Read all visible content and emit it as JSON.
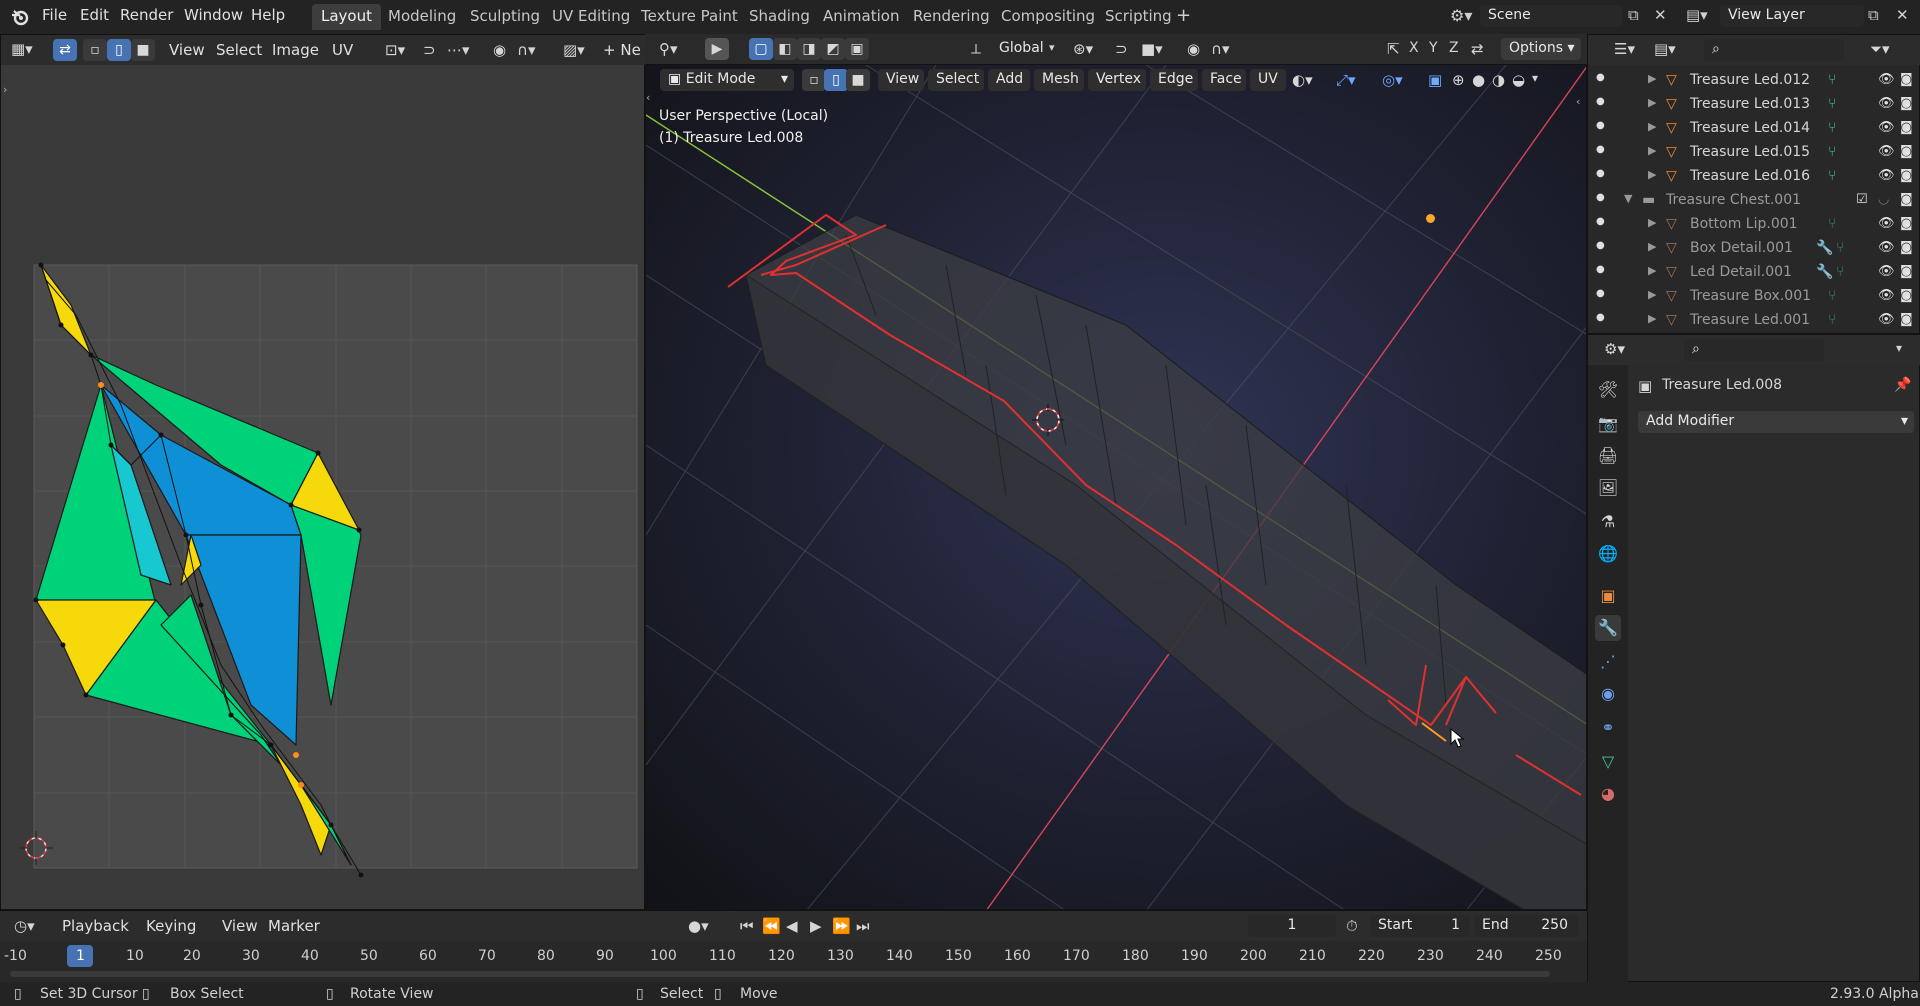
{
  "app": {
    "version": "2.93.0 Alpha"
  },
  "menu": [
    "File",
    "Edit",
    "Render",
    "Window",
    "Help"
  ],
  "workspaces": [
    "Layout",
    "Modeling",
    "Sculpting",
    "UV Editing",
    "Texture Paint",
    "Shading",
    "Animation",
    "Rendering",
    "Compositing",
    "Scripting"
  ],
  "active_workspace": "Layout",
  "scene": {
    "name": "Scene",
    "view_layer": "View Layer"
  },
  "uv_editor": {
    "menus": [
      "View",
      "Select",
      "Image",
      "UV"
    ],
    "new_label": "Ne"
  },
  "viewport_toolbar": {
    "orientation": "Global",
    "options": "Options",
    "axes": [
      "X",
      "Y",
      "Z"
    ]
  },
  "viewport_header": {
    "mode": "Edit Mode",
    "menus": [
      "View",
      "Select",
      "Add",
      "Mesh",
      "Vertex",
      "Edge",
      "Face",
      "UV"
    ]
  },
  "viewport_overlay": {
    "perspective": "User Perspective (Local)",
    "object": "(1) Treasure Led.008"
  },
  "outliner": {
    "rows": [
      {
        "name": "Treasure Led.012",
        "dim": false,
        "kind": "mesh"
      },
      {
        "name": "Treasure Led.013",
        "dim": false,
        "kind": "mesh"
      },
      {
        "name": "Treasure Led.014",
        "dim": false,
        "kind": "mesh"
      },
      {
        "name": "Treasure Led.015",
        "dim": false,
        "kind": "mesh"
      },
      {
        "name": "Treasure Led.016",
        "dim": false,
        "kind": "mesh"
      },
      {
        "name": "Treasure Chest.001",
        "dim": true,
        "kind": "collection"
      },
      {
        "name": "Bottom Lip.001",
        "dim": true,
        "kind": "mesh"
      },
      {
        "name": "Box Detail.001",
        "dim": true,
        "kind": "mesh"
      },
      {
        "name": "Led Detail.001",
        "dim": true,
        "kind": "mesh"
      },
      {
        "name": "Treasure Box.001",
        "dim": true,
        "kind": "mesh"
      },
      {
        "name": "Treasure Led.001",
        "dim": true,
        "kind": "mesh"
      }
    ]
  },
  "properties": {
    "object_name": "Treasure Led.008",
    "add_modifier": "Add Modifier"
  },
  "timeline": {
    "menus": [
      "Playback",
      "Keying",
      "View",
      "Marker"
    ],
    "current_frame": "1",
    "start_label": "Start",
    "start": "1",
    "end_label": "End",
    "end": "250",
    "ruler": [
      "-10",
      "1",
      "10",
      "20",
      "30",
      "40",
      "50",
      "60",
      "70",
      "80",
      "90",
      "100",
      "110",
      "120",
      "130",
      "140",
      "150",
      "160",
      "170",
      "180",
      "190",
      "200",
      "210",
      "220",
      "230",
      "240",
      "250"
    ]
  },
  "statusbar": {
    "items": [
      "Set 3D Cursor",
      "Box Select",
      "Rotate View",
      "Select",
      "Move"
    ]
  },
  "colors": {
    "accent": "#4772b3",
    "selection": "#e03030",
    "uv_teal": "#00d27a",
    "uv_blue": "#0f8fd6",
    "uv_yellow": "#f5d90a"
  }
}
